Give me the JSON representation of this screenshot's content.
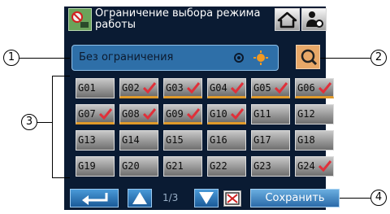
{
  "header": {
    "title": "Ограничение выбора режима работы"
  },
  "status": {
    "text": "Без ограничения"
  },
  "grid": [
    {
      "label": "G01",
      "checked": false
    },
    {
      "label": "G02",
      "checked": true
    },
    {
      "label": "G03",
      "checked": true
    },
    {
      "label": "G04",
      "checked": true
    },
    {
      "label": "G05",
      "checked": true
    },
    {
      "label": "G06",
      "checked": true
    },
    {
      "label": "G07",
      "checked": true
    },
    {
      "label": "G08",
      "checked": true
    },
    {
      "label": "G09",
      "checked": true
    },
    {
      "label": "G10",
      "checked": true
    },
    {
      "label": "G11",
      "checked": false
    },
    {
      "label": "G12",
      "checked": false
    },
    {
      "label": "G13",
      "checked": false
    },
    {
      "label": "G14",
      "checked": false
    },
    {
      "label": "G15",
      "checked": false
    },
    {
      "label": "G16",
      "checked": false
    },
    {
      "label": "G17",
      "checked": false
    },
    {
      "label": "G18",
      "checked": false
    },
    {
      "label": "G19",
      "checked": false
    },
    {
      "label": "G20",
      "checked": false
    },
    {
      "label": "G21",
      "checked": false
    },
    {
      "label": "G22",
      "checked": false
    },
    {
      "label": "G23",
      "checked": false
    },
    {
      "label": "G24",
      "checked": true
    }
  ],
  "footer": {
    "page_indicator": "1/3",
    "save_label": "Сохранить"
  },
  "callouts": {
    "c1": "1",
    "c2": "2",
    "c3": "3",
    "c4": "4"
  },
  "colors": {
    "panel": "#0a1b33",
    "check": "#e0303a",
    "selected_underline": "#e09a2a"
  }
}
